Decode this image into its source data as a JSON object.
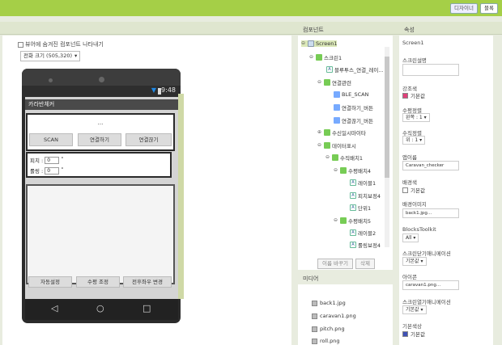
{
  "top": {
    "designer_label": "디자이너",
    "blocks_label": "블록"
  },
  "viewer": {
    "hidden_checkbox_label": "뷰어에 숨겨진 컴포넌트 나타내기",
    "size_select": "전화 크기 (505,320)",
    "phone": {
      "status_time": "9:48",
      "app_title": "카라반체커",
      "ellipsis": "...",
      "scan_button": "SCAN",
      "connect_button": "연결하기",
      "disconnect_button": "연결끊기",
      "pitch_label": "피치 :",
      "pitch_value": "0",
      "pitch_unit": "˚",
      "roll_label": "롤링 :",
      "roll_value": "0",
      "roll_unit": "˚",
      "auto_button": "자동설정",
      "manual_button": "수평 조정",
      "toggle_button": "전후좌우 변경"
    }
  },
  "components": {
    "title": "컴포넌트",
    "tree": [
      {
        "label": "Screen1"
      },
      {
        "label": "스크린1"
      },
      {
        "label": "블루투스_연결_레이..."
      },
      {
        "label": "연결관련"
      },
      {
        "label": "BLE_SCAN"
      },
      {
        "label": "연결하기_버튼"
      },
      {
        "label": "연결끊기_버튼"
      },
      {
        "label": "수신일시마이타"
      },
      {
        "label": "데이터표시"
      },
      {
        "label": "수직배치1"
      },
      {
        "label": "수평배치4"
      },
      {
        "label": "레이블1"
      },
      {
        "label": "피치보정4"
      },
      {
        "label": "단위1"
      },
      {
        "label": "수평배치5"
      },
      {
        "label": "레이블2"
      },
      {
        "label": "롤링보정4"
      }
    ],
    "rename_button": "이름 바꾸기",
    "delete_button": "삭제"
  },
  "media": {
    "title": "미디어",
    "items": [
      "back1.jpg",
      "caravan1.png",
      "pitch.png",
      "roll.png"
    ]
  },
  "properties": {
    "title": "속성",
    "component": "Screen1",
    "description_label": "스크린설명",
    "accent_label": "강조색",
    "accent_value": "기본값",
    "align_h_label": "수평정렬",
    "align_h_value": "왼쪽 : 1",
    "align_v_label": "수직정렬",
    "align_v_value": "위 : 1",
    "appname_label": "앱이름",
    "appname_value": "Caravan_checker",
    "bg_label": "배경색",
    "bg_value": "기본값",
    "bgimage_label": "배경이미지",
    "bgimage_value": "back1.jpg...",
    "blocks_toolkit_label": "BlocksToolkit",
    "blocks_toolkit_value": "All",
    "close_anim_label": "스크린닫기애니메이션",
    "close_anim_value": "기본값",
    "icon_label": "아이콘",
    "icon_value": "caravan1.png...",
    "open_anim_label": "스크린열기애니메이션",
    "open_anim_value": "기본값",
    "primary_label": "기본색상",
    "primary_value": "기본값"
  },
  "colors": {
    "accent_swatch": "#e0407a",
    "primary_swatch": "#3f51b5",
    "topbar": "#a5cf47"
  }
}
